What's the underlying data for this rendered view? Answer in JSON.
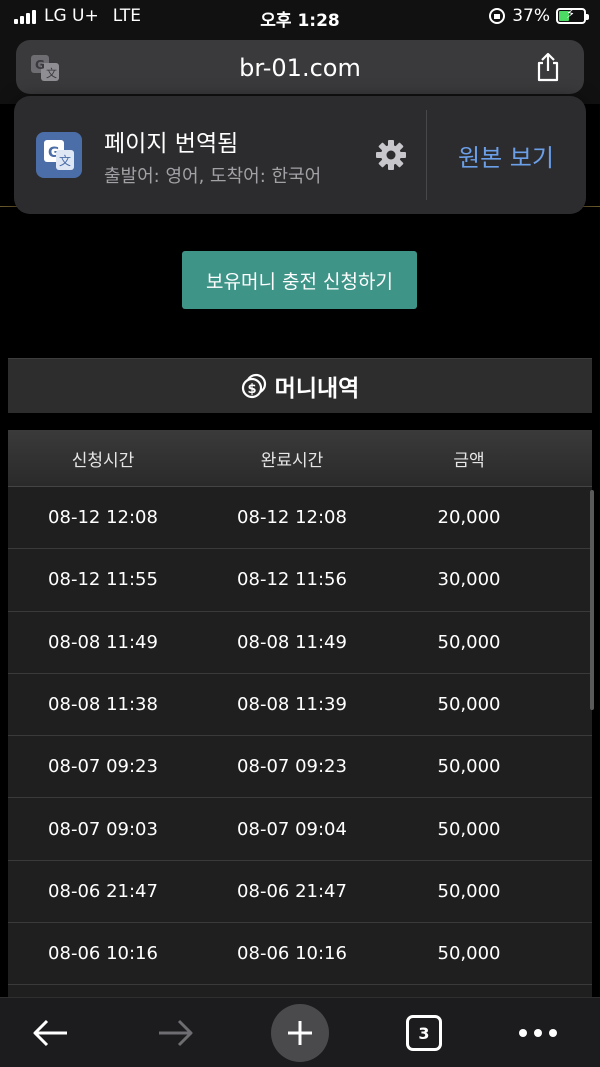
{
  "status_bar": {
    "carrier": "LG U+",
    "network": "LTE",
    "time": "오후 1:28",
    "battery": "37%",
    "battery_level": 0.37
  },
  "browser": {
    "url": "br-01.com"
  },
  "translate_popup": {
    "title": "페이지 번역됨",
    "subtitle": "출발어: 영어, 도착어: 한국어",
    "original_button": "원본 보기"
  },
  "page": {
    "charge_button": "보유머니 충전 신청하기",
    "section_title": "머니내역",
    "table": {
      "headers": [
        "신청시간",
        "완료시간",
        "금액"
      ],
      "rows": [
        [
          "08-12 12:08",
          "08-12 12:08",
          "20,000"
        ],
        [
          "08-12 11:55",
          "08-12 11:56",
          "30,000"
        ],
        [
          "08-08 11:49",
          "08-08 11:49",
          "50,000"
        ],
        [
          "08-08 11:38",
          "08-08 11:39",
          "50,000"
        ],
        [
          "08-07 09:23",
          "08-07 09:23",
          "50,000"
        ],
        [
          "08-07 09:03",
          "08-07 09:04",
          "50,000"
        ],
        [
          "08-06 21:47",
          "08-06 21:47",
          "50,000"
        ],
        [
          "08-06 10:16",
          "08-06 10:16",
          "50,000"
        ]
      ]
    }
  },
  "toolbar": {
    "tab_count": "3"
  },
  "colors": {
    "accent_button": "#3f9488",
    "link_blue": "#6b9fe8",
    "battery_green": "#4cd964"
  }
}
